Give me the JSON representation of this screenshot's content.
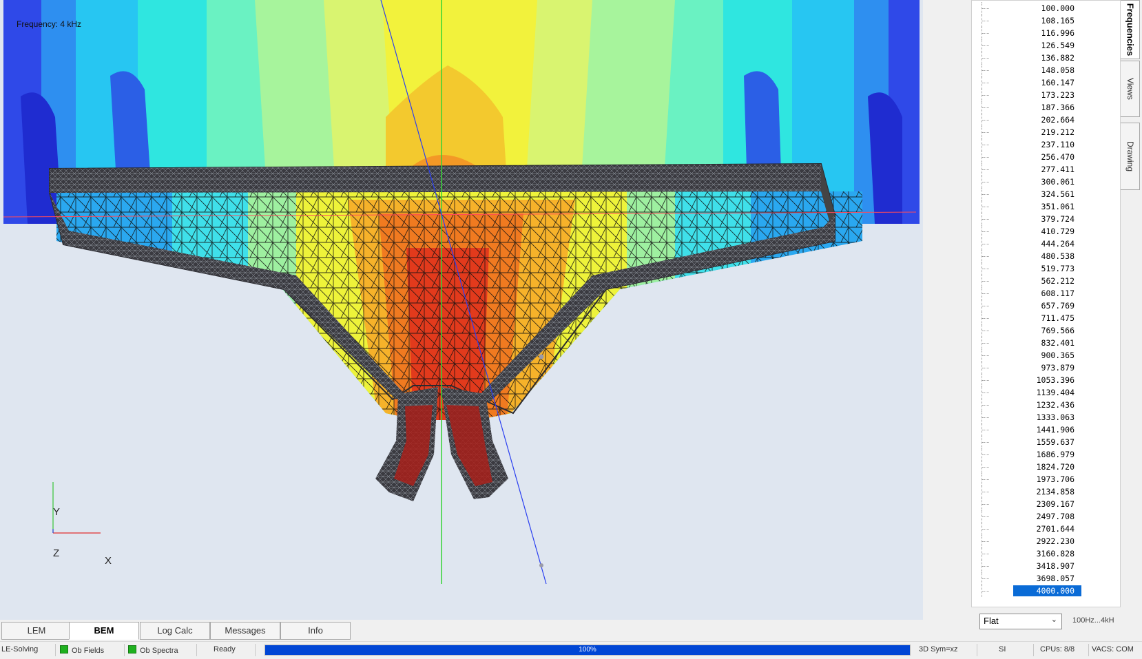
{
  "viewport": {
    "title": "Frequency: 4 kHz",
    "axes": {
      "y": "Y",
      "z": "Z",
      "x": "X"
    }
  },
  "bottom_tabs": [
    {
      "label": "LEM",
      "active": false
    },
    {
      "label": "BEM",
      "active": true
    },
    {
      "label": "Log Calc",
      "active": false
    },
    {
      "label": "Messages",
      "active": false
    },
    {
      "label": "Info",
      "active": false
    }
  ],
  "status": {
    "le_solving": "LE-Solving",
    "ob_fields": "Ob Fields",
    "ob_spectra": "Ob Spectra",
    "state": "Ready",
    "progress_text": "100%",
    "progress_value": 1.0,
    "sym": "3D Sym=xz",
    "units": "SI",
    "cpus": "CPUs: 8/8",
    "vacs": "VACS: COM"
  },
  "side_tabs": [
    {
      "label": "Frequencies",
      "active": true
    },
    {
      "label": "Views",
      "active": false
    },
    {
      "label": "Drawing",
      "active": false
    }
  ],
  "frequencies": [
    "100.000",
    "108.165",
    "116.996",
    "126.549",
    "136.882",
    "148.058",
    "160.147",
    "173.223",
    "187.366",
    "202.664",
    "219.212",
    "237.110",
    "256.470",
    "277.411",
    "300.061",
    "324.561",
    "351.061",
    "379.724",
    "410.729",
    "444.264",
    "480.538",
    "519.773",
    "562.212",
    "608.117",
    "657.769",
    "711.475",
    "769.566",
    "832.401",
    "900.365",
    "973.879",
    "1053.396",
    "1139.404",
    "1232.436",
    "1333.063",
    "1441.906",
    "1559.637",
    "1686.979",
    "1824.720",
    "1973.706",
    "2134.858",
    "2309.167",
    "2497.708",
    "2701.644",
    "2922.230",
    "3160.828",
    "3418.907",
    "3698.057",
    "4000.000"
  ],
  "selected_frequency": "4000.000",
  "weighting": {
    "value": "Flat"
  },
  "range_label": "100Hz...4kH",
  "colors": {
    "accent": "#0a6bd6",
    "progress": "#0046d5",
    "led": "#1fb01f"
  }
}
